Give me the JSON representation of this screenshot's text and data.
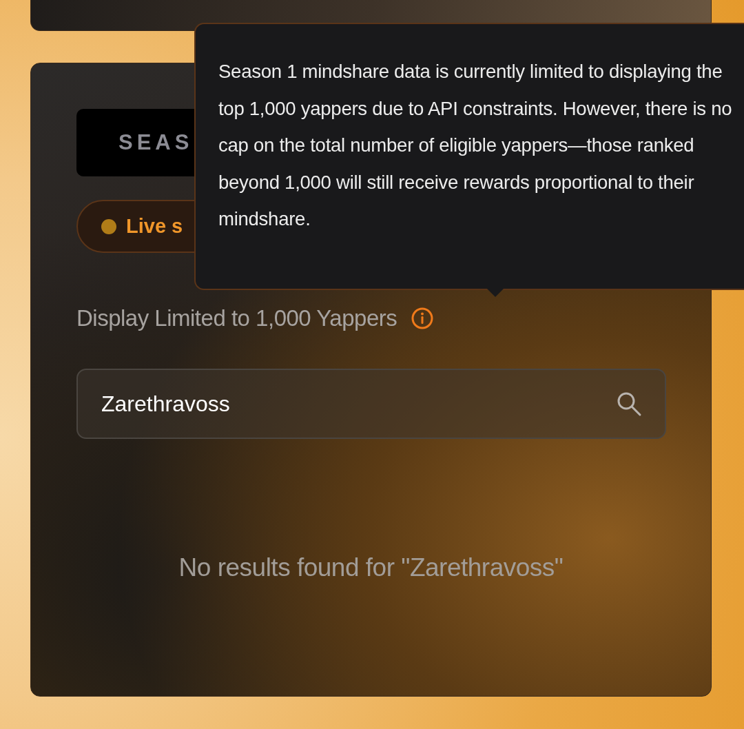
{
  "season_button": {
    "label": "SEAS"
  },
  "status_pill": {
    "label": "Live s"
  },
  "display_limit": {
    "label": "Display Limited to 1,000 Yappers"
  },
  "tooltip": {
    "text": "Season 1 mindshare data is currently limited to displaying the top 1,000 yappers due to API constraints. However, there is no cap on the total number of eligible yappers—those ranked beyond 1,000 will still receive rewards proportional to their mindshare."
  },
  "search": {
    "value": "Zarethravoss"
  },
  "empty_message": "No results found for \"Zarethravoss\""
}
